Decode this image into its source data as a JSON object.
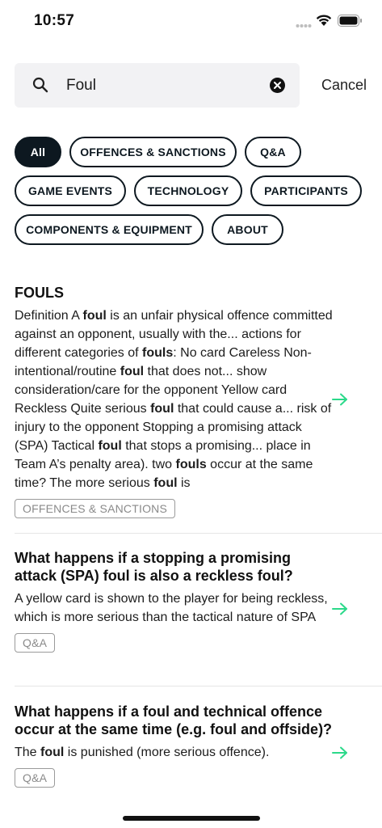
{
  "status": {
    "time": "10:57"
  },
  "search": {
    "value": "Foul",
    "placeholder": "",
    "cancel_label": "Cancel"
  },
  "filters": [
    {
      "label": "All",
      "active": true
    },
    {
      "label": "OFFENCES & SANCTIONS",
      "active": false
    },
    {
      "label": "Q&A",
      "active": false
    },
    {
      "label": "GAME EVENTS",
      "active": false
    },
    {
      "label": "TECHNOLOGY",
      "active": false
    },
    {
      "label": "PARTICIPANTS",
      "active": false
    },
    {
      "label": "COMPONENTS & EQUIPMENT",
      "active": false
    },
    {
      "label": "ABOUT",
      "active": false
    }
  ],
  "results": [
    {
      "title": "FOULS",
      "snippet": [
        {
          "t": "Definition A "
        },
        {
          "t": "foul",
          "b": true
        },
        {
          "t": " is an unfair physical offence committed against an opponent, usually with the... actions for different categories of "
        },
        {
          "t": "fouls",
          "b": true
        },
        {
          "t": ": No card Careless Non-intentional/routine "
        },
        {
          "t": "foul",
          "b": true
        },
        {
          "t": " that does not... show consideration/care for the opponent Yellow card Reckless Quite serious "
        },
        {
          "t": "foul",
          "b": true
        },
        {
          "t": " that could cause a...  risk of injury to the opponent Stopping a promising attack (SPA) Tactical "
        },
        {
          "t": "foul",
          "b": true
        },
        {
          "t": " that stops a promising...  place in Team A’s penalty area). two "
        },
        {
          "t": "fouls",
          "b": true
        },
        {
          "t": " occur at the same time? The more serious "
        },
        {
          "t": "foul",
          "b": true
        },
        {
          "t": " is"
        }
      ],
      "tag": "OFFENCES & SANCTIONS"
    },
    {
      "title": "What happens if a stopping a promising attack (SPA) foul is also a reckless foul?",
      "snippet": [
        {
          "t": "A yellow card is shown to the player for being reckless, which is more serious than the tactical nature of SPA"
        }
      ],
      "tag": "Q&A"
    },
    {
      "title": "What happens if a foul and technical offence occur at the same time (e.g. foul and offside)?",
      "snippet": [
        {
          "t": "The "
        },
        {
          "t": "foul",
          "b": true
        },
        {
          "t": " is punished (more serious offence)."
        }
      ],
      "tag": "Q&A"
    }
  ],
  "colors": {
    "chip_dark": "#0d1820",
    "arrow": "#2bd98a",
    "search_bg": "#f2f2f4"
  }
}
